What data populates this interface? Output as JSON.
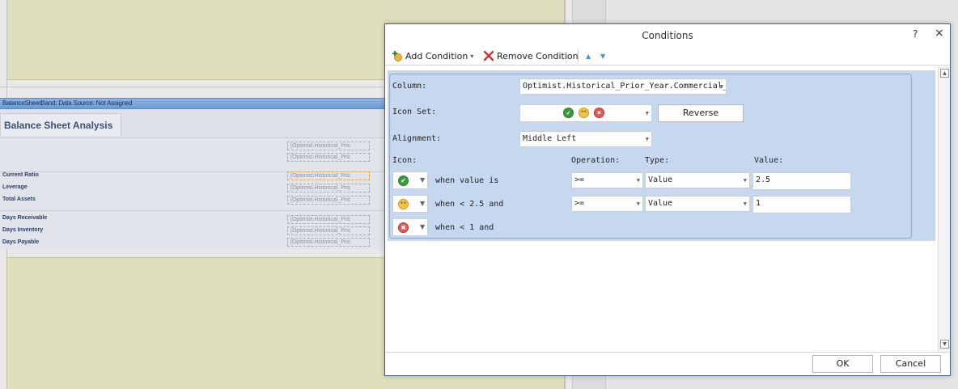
{
  "report": {
    "band_label": "BalanceSheetBand; Data Source: Not Assigned",
    "title": "Balance Sheet Analysis",
    "metrics_group1": [
      "Current Ratio",
      "Leverage",
      "Total Assets"
    ],
    "metrics_group2": [
      "Days Receivable",
      "Days Inventory",
      "Days Payable"
    ],
    "field_cell_text": "[Optimist.Historical_Pric"
  },
  "dialog": {
    "title": "Conditions",
    "help_label": "?",
    "close_label": "×",
    "toolbar": {
      "add_label": "Add Condition",
      "add_arrow": "▾",
      "remove_label": "Remove Condition",
      "move_up": "▲",
      "move_down": "▼"
    },
    "column": {
      "label": "Column:",
      "value": "Optimist.Historical_Prior_Year.Commercial_ar"
    },
    "icon_set": {
      "label": "Icon Set:",
      "icons": [
        "check-green",
        "warning-yellow",
        "cross-red"
      ]
    },
    "reverse_label": "Reverse",
    "alignment": {
      "label": "Alignment:",
      "value": "Middle Left"
    },
    "headers": {
      "icon": "Icon:",
      "operation": "Operation:",
      "type": "Type:",
      "value": "Value:"
    },
    "conditions": [
      {
        "icon": "check-green",
        "text": "when value is",
        "operation": ">=",
        "type": "Value",
        "value": "2.5"
      },
      {
        "icon": "warning-yellow",
        "text": "when < 2.5 and",
        "operation": ">=",
        "type": "Value",
        "value": "1"
      },
      {
        "icon": "cross-red",
        "text": "when < 1 and"
      }
    ],
    "ok_label": "OK",
    "cancel_label": "Cancel",
    "dropdown_arrow": "▼"
  },
  "colors": {
    "dialog_border": "#44638f",
    "panel_bg": "#c6d7f0",
    "band_blue": "#7aa6dd",
    "designer_yellow": "#e0dfbd",
    "ok_green": "#3c9a3c",
    "warn_yellow": "#f3c04c",
    "error_red": "#e05a5a",
    "remove_red": "#d63131"
  }
}
